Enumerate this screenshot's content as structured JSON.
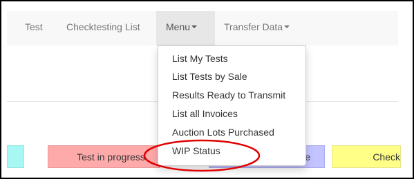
{
  "navbar": {
    "items": [
      {
        "label": "Test"
      },
      {
        "label": "Checktesting List"
      },
      {
        "label": "Menu",
        "dropdown": true,
        "active": true
      },
      {
        "label": "Transfer Data",
        "dropdown": true
      }
    ]
  },
  "menu_dropdown": {
    "items": [
      {
        "label": "List My Tests"
      },
      {
        "label": "List Tests by Sale"
      },
      {
        "label": "Results Ready to Transmit"
      },
      {
        "label": "List all Invoices"
      },
      {
        "label": "Auction Lots Purchased"
      },
      {
        "label": "WIP Status",
        "highlighted": true
      }
    ]
  },
  "status_legend": {
    "items": [
      {
        "label": "",
        "color": "#a7f8f3"
      },
      {
        "label": "Test in progress",
        "color": "#ffaaaa"
      },
      {
        "label": "e",
        "color": "#c3c3ff"
      },
      {
        "label": "Check",
        "color": "#ffff88"
      }
    ]
  },
  "annotation": {
    "color": "#e00000",
    "target": "WIP Status"
  }
}
